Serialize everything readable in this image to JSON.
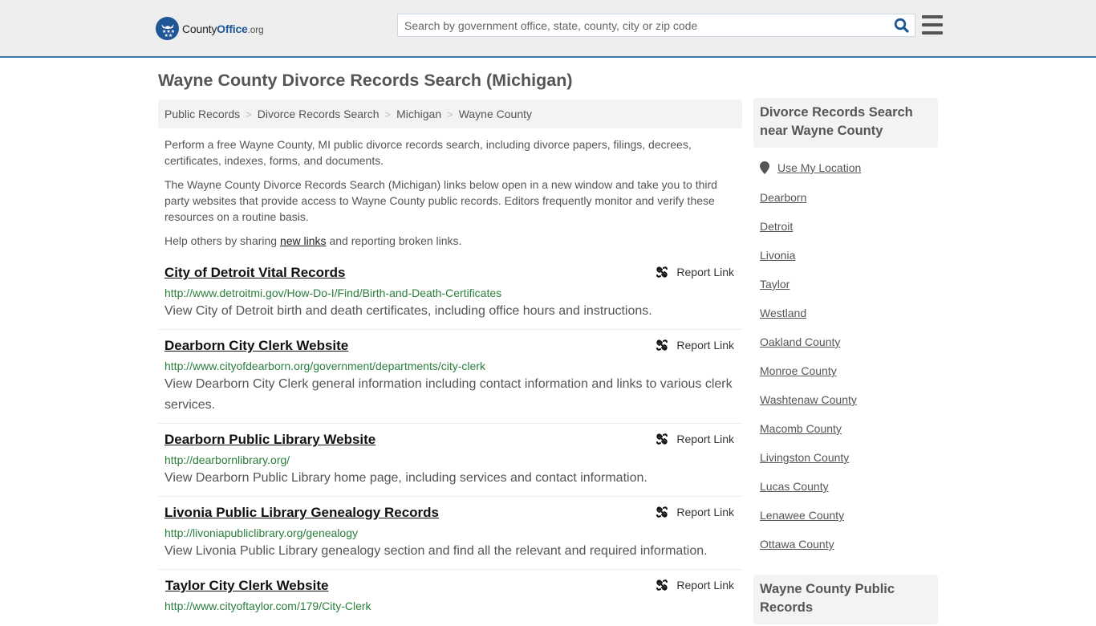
{
  "header": {
    "logo": {
      "prefix": "County",
      "brand": "Office",
      "suffix": ".org"
    },
    "search": {
      "placeholder": "Search by government office, state, county, city or zip code",
      "value": ""
    },
    "colors": {
      "brand": "#1f5696",
      "header_bg": "#eeeeee",
      "accent_line": "#3b77ad"
    }
  },
  "page": {
    "title": "Wayne County Divorce Records Search (Michigan)",
    "breadcrumb": [
      "Public Records",
      "Divorce Records Search",
      "Michigan",
      "Wayne County"
    ],
    "intro": {
      "p1": "Perform a free Wayne County, MI public divorce records search, including divorce papers, filings, decrees, certificates, indexes, forms, and documents.",
      "p2": "The Wayne County Divorce Records Search (Michigan) links below open in a new window and take you to third party websites that provide access to Wayne County public records. Editors frequently monitor and verify these resources on a routine basis.",
      "p3_before": "Help others by sharing ",
      "p3_link": "new links",
      "p3_after": " and reporting broken links."
    },
    "report_label": "Report Link",
    "results": [
      {
        "title": "City of Detroit Vital Records",
        "url": "http://www.detroitmi.gov/How-Do-I/Find/Birth-and-Death-Certificates",
        "description": "View City of Detroit birth and death certificates, including office hours and instructions."
      },
      {
        "title": "Dearborn City Clerk Website",
        "url": "http://www.cityofdearborn.org/government/departments/city-clerk",
        "description": "View Dearborn City Clerk general information including contact information and links to various clerk services."
      },
      {
        "title": "Dearborn Public Library Website",
        "url": "http://dearbornlibrary.org/",
        "description": "View Dearborn Public Library home page, including services and contact information."
      },
      {
        "title": "Livonia Public Library Genealogy Records",
        "url": "http://livoniapubliclibrary.org/genealogy",
        "description": "View Livonia Public Library genealogy section and find all the relevant and required information."
      },
      {
        "title": "Taylor City Clerk Website",
        "url": "http://www.cityoftaylor.com/179/City-Clerk",
        "description": ""
      }
    ]
  },
  "sidebar": {
    "nearby_heading": "Divorce Records Search near Wayne County",
    "use_location": "Use My Location",
    "nearby_links": [
      "Dearborn",
      "Detroit",
      "Livonia",
      "Taylor",
      "Westland",
      "Oakland County",
      "Monroe County",
      "Washtenaw County",
      "Macomb County",
      "Livingston County",
      "Lucas County",
      "Lenawee County",
      "Ottawa County"
    ],
    "public_records_heading": "Wayne County Public Records"
  }
}
